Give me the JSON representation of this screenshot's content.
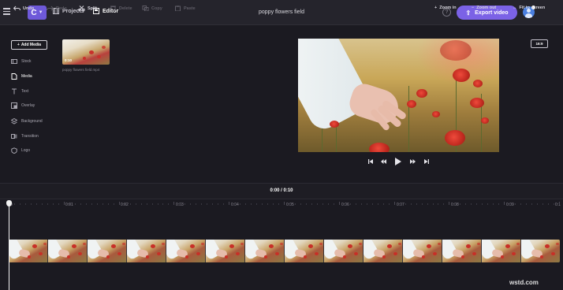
{
  "topbar": {
    "brand_letter": "C",
    "projects_label": "Projects",
    "editor_label": "Editor",
    "project_title": "poppy flowers field",
    "help_symbol": "?",
    "export_label": "Export video",
    "export_icon": "upload-arrow-icon",
    "accent_color": "#7b62e6"
  },
  "sidebar": {
    "add_media_label": "Add Media",
    "items": [
      {
        "label": "Stock",
        "icon": "stock-icon",
        "active": false
      },
      {
        "label": "Media",
        "icon": "media-icon",
        "active": true
      },
      {
        "label": "Text",
        "icon": "text-icon",
        "active": false
      },
      {
        "label": "Overlay",
        "icon": "overlay-icon",
        "active": false
      },
      {
        "label": "Background",
        "icon": "background-icon",
        "active": false
      },
      {
        "label": "Transition",
        "icon": "transition-icon",
        "active": false
      },
      {
        "label": "Logo",
        "icon": "logo-icon",
        "active": false
      }
    ]
  },
  "media_library": {
    "clip_duration": "0:10",
    "clip_name": "poppy flowers field.mp4"
  },
  "preview": {
    "aspect_ratio": "16:9"
  },
  "toolbar": {
    "undo": "Undo",
    "redo": "Redo",
    "split": "Split",
    "delete": "Delete",
    "copy": "Copy",
    "paste": "Paste",
    "timecode": "0:00 / 0:10",
    "zoom_in": "Zoom in",
    "zoom_out": "Zoom out",
    "fit": "Fit to screen"
  },
  "ruler": {
    "ticks": [
      "0",
      "0:01",
      "0:02",
      "0:03",
      "0:04",
      "0:05",
      "0:06",
      "0:07",
      "0:08",
      "0:09",
      "0:1"
    ]
  },
  "timeline": {
    "frame_count": 14
  },
  "watermark": "wstd.com"
}
